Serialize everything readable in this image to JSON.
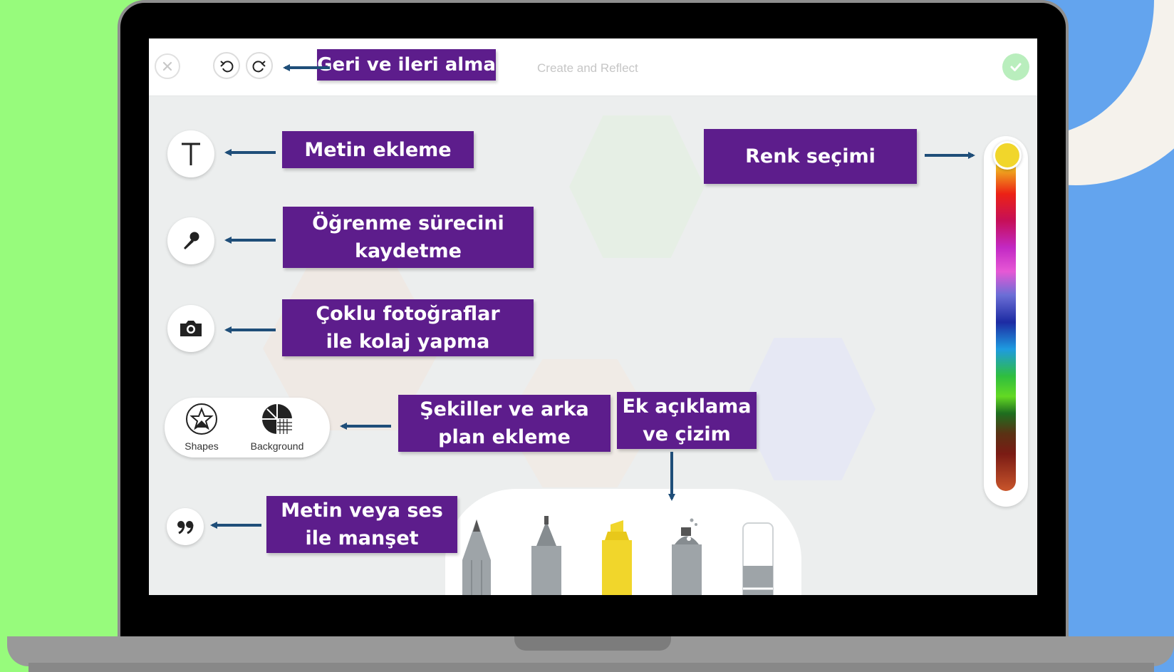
{
  "app": {
    "title": "Create and Reflect"
  },
  "tools": {
    "shapes_label": "Shapes",
    "background_label": "Background"
  },
  "annotations": {
    "undo_redo": "Geri ve ileri alma",
    "add_text": "Metin ekleme",
    "record_learning": "Öğrenme sürecini\nkaydetme",
    "photo_collage": "Çoklu fotoğraflar\nile kolaj yapma",
    "shapes_background": "Şekiller ve arka\nplan ekleme",
    "annotation_drawing": "Ek açıklama\nve çizim",
    "caption": "Metin veya ses\nile manşet",
    "color_selection": "Renk seçimi"
  },
  "colors": {
    "label_bg": "#5d1d8c",
    "arrow": "#1f4e79",
    "page_green": "#97fb7c",
    "page_blue": "#63a4ee",
    "selected_color": "#f1d62b"
  },
  "icons": {
    "close": "close-icon",
    "undo": "undo-icon",
    "redo": "redo-icon",
    "done": "checkmark-icon",
    "text": "text-icon",
    "mic": "microphone-icon",
    "camera": "camera-icon",
    "quote": "quote-icon",
    "shapes": "star-shape-icon",
    "background": "background-grid-icon"
  }
}
